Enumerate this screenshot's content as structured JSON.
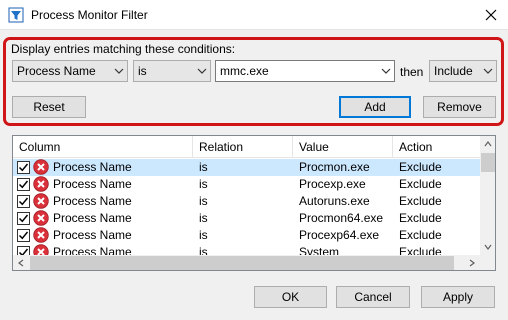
{
  "window": {
    "title": "Process Monitor Filter",
    "close_icon": "close-icon",
    "app_icon": "filter-funnel-icon"
  },
  "condition": {
    "label": "Display entries matching these conditions:",
    "column_value": "Process Name",
    "relation_value": "is",
    "value_value": "mmc.exe",
    "then_label": "then",
    "action_value": "Include",
    "reset_label": "Reset",
    "add_label": "Add",
    "remove_label": "Remove",
    "highlight_color": "#d01518"
  },
  "list": {
    "headers": [
      "Column",
      "Relation",
      "Value",
      "Action"
    ],
    "rows": [
      {
        "checked": true,
        "column": "Process Name",
        "relation": "is",
        "value": "Procmon.exe",
        "action": "Exclude"
      },
      {
        "checked": true,
        "column": "Process Name",
        "relation": "is",
        "value": "Procexp.exe",
        "action": "Exclude"
      },
      {
        "checked": true,
        "column": "Process Name",
        "relation": "is",
        "value": "Autoruns.exe",
        "action": "Exclude"
      },
      {
        "checked": true,
        "column": "Process Name",
        "relation": "is",
        "value": "Procmon64.exe",
        "action": "Exclude"
      },
      {
        "checked": true,
        "column": "Process Name",
        "relation": "is",
        "value": "Procexp64.exe",
        "action": "Exclude"
      },
      {
        "checked": true,
        "column": "Process Name",
        "relation": "is",
        "value": "System",
        "action": "Exclude"
      }
    ],
    "row_icon": "exclude-x-icon",
    "selected_row_color": "#cce8ff"
  },
  "footer": {
    "ok_label": "OK",
    "cancel_label": "Cancel",
    "apply_label": "Apply"
  }
}
